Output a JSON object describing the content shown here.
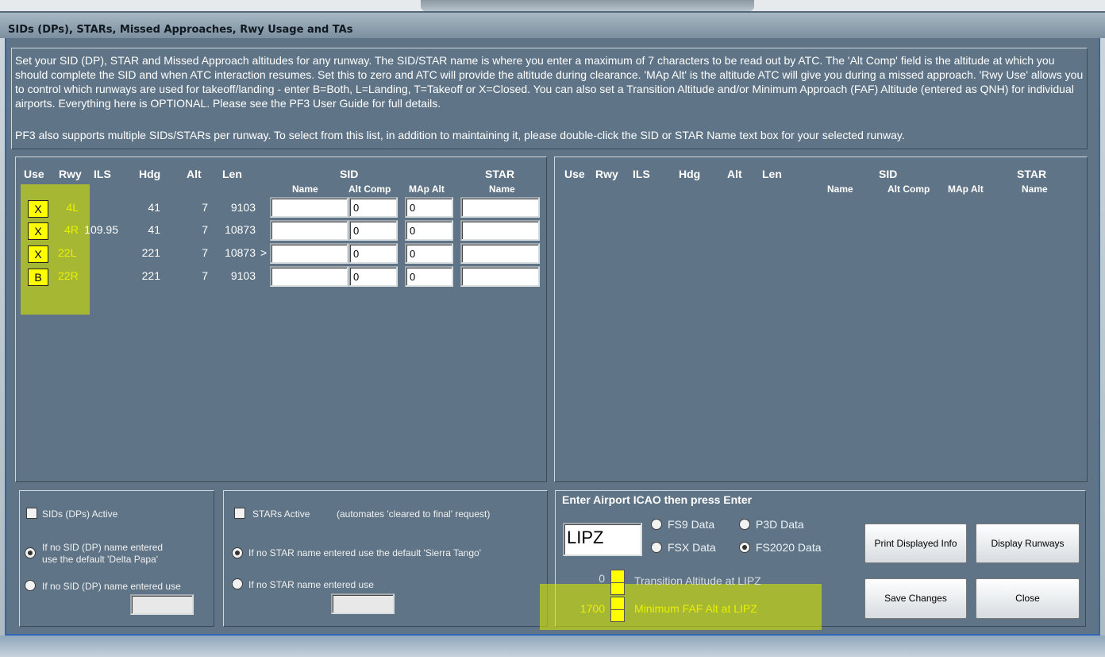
{
  "window": {
    "title": "SIDs (DPs), STARs, Missed Approaches, Rwy Usage and TAs"
  },
  "description": {
    "paragraph1": "Set your SID (DP), STAR and Missed Approach altitudes for any runway. The SID/STAR name is where you enter a maximum of 7 characters to be read out by ATC. The 'Alt Comp' field is the altitude at which you should complete the SID and when ATC interaction resumes. Set this to zero and ATC will provide the altitude during clearance. 'MAp Alt' is the altitude ATC will give you during a missed approach. 'Rwy Use' allows you to control which runways are used for takeoff/landing - enter B=Both, L=Landing, T=Takeoff or X=Closed.  You can also set a Transition Altitude and/or Minimum Approach (FAF) Altitude (entered as QNH) for individual airports. Everything here is OPTIONAL. Please see the PF3 User Guide for full details.",
    "paragraph2": "PF3 also supports multiple SIDs/STARs per runway. To select from this list, in addition to maintaining it, please double-click the SID or STAR Name text box for your selected runway."
  },
  "table_headers": {
    "use": "Use",
    "rwy": "Rwy",
    "ils": "ILS",
    "hdg": "Hdg",
    "alt": "Alt",
    "len": "Len",
    "sid": "SID",
    "star": "STAR",
    "name": "Name",
    "alt_comp": "Alt Comp",
    "map_alt": "MAp Alt",
    "star_name": "Name"
  },
  "runways": [
    {
      "use": "X",
      "rwy": "4L",
      "ils": "",
      "hdg": "41",
      "alt": "7",
      "len": "9103",
      "sid_name": "",
      "alt_comp": "0",
      "map_alt": "0",
      "star_name": "",
      "marker": ""
    },
    {
      "use": "X",
      "rwy": "4R",
      "ils": "109.95",
      "hdg": "41",
      "alt": "7",
      "len": "10873",
      "sid_name": "",
      "alt_comp": "0",
      "map_alt": "0",
      "star_name": "",
      "marker": ""
    },
    {
      "use": "X",
      "rwy": "22L",
      "ils": "",
      "hdg": "221",
      "alt": "7",
      "len": "10873",
      "sid_name": "",
      "alt_comp": "0",
      "map_alt": "0",
      "star_name": "",
      "marker": ">"
    },
    {
      "use": "B",
      "rwy": "22R",
      "ils": "",
      "hdg": "221",
      "alt": "7",
      "len": "9103",
      "sid_name": "",
      "alt_comp": "0",
      "map_alt": "0",
      "star_name": "",
      "marker": ""
    }
  ],
  "sid_panel": {
    "active_label": "SIDs (DPs) Active",
    "default_option": "If no SID (DP) name entered use the default 'Delta Papa'",
    "default_option_line1": "If no SID (DP) name entered",
    "default_option_line2": "use the default 'Delta Papa'",
    "custom_option": "If no SID (DP) name entered use",
    "custom_value": ""
  },
  "star_panel": {
    "active_label": "STARs Active",
    "active_note": "(automates 'cleared to final' request)",
    "default_option": "If no STAR name entered use the default 'Sierra Tango'",
    "custom_option": "If no STAR name entered use",
    "custom_value": ""
  },
  "airport_panel": {
    "heading": "Enter Airport ICAO then press Enter",
    "icao": "LIPZ",
    "data_options": [
      "FS9 Data",
      "P3D Data",
      "FSX Data",
      "FS2020 Data"
    ],
    "selected_data": "FS2020 Data",
    "transition_alt_value": "0",
    "transition_alt_label": "Transition Altitude at LIPZ",
    "faf_alt_value": "1700",
    "faf_alt_label": "Minimum FAF Alt at LIPZ"
  },
  "buttons": {
    "print": "Print Displayed Info",
    "display_runways": "Display Runways",
    "save": "Save Changes",
    "close": "Close"
  },
  "colors": {
    "highlight": "#d2e100",
    "panel": "#5f7486",
    "use_box": "#ffff00",
    "border_accent": "#2f66b8"
  }
}
